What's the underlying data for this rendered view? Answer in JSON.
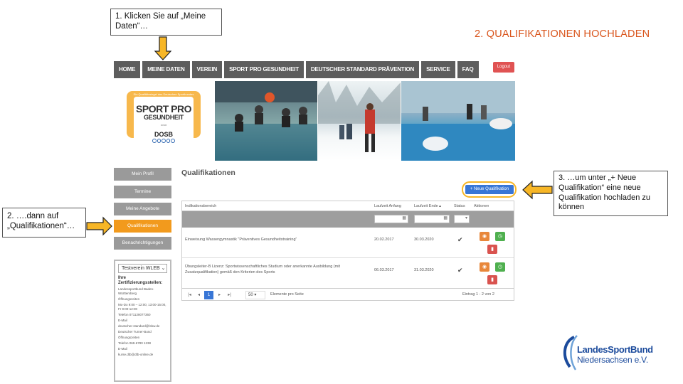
{
  "annotations": {
    "callout_1": "1. Klicken Sie auf „Meine Daten“…",
    "callout_2": "2. ….dann auf „Qualifikationen“…",
    "callout_3": "3. …um unter „+ Neue Qualifikation“ eine neue Qualifikation hochladen zu können",
    "slide_title": "2. QUALIFIKATIONEN HOCHLADEN",
    "step_1": "1",
    "step_2": "2",
    "colors": {
      "title": "#d9541b",
      "highlight": "#f7b626",
      "arrow": "#222222"
    }
  },
  "nav": {
    "items": [
      "HOME",
      "MEINE DATEN",
      "VEREIN",
      "SPORT PRO GESUNDHEIT",
      "DEUTSCHER STANDARD PRÄVENTION",
      "SERVICE",
      "FAQ"
    ],
    "login": "Logout"
  },
  "logo": {
    "topline": "Ein Qualitätssiegel des Deutschen Sportbundes",
    "line1": "SPORT PRO",
    "line2": "GESUNDHEIT",
    "sub": "DOSB",
    "dosb": "DOSB"
  },
  "sidebar": {
    "items": [
      "Mein Profil",
      "Termine",
      "Meine Angebote",
      "Qualifikationen",
      "Benachrichtigungen"
    ],
    "active_index": 3
  },
  "widget": {
    "select": "Testverein WLEB",
    "heading": "Ihre Zertifizierungsstellen:",
    "lines": [
      "Landessportbund Baden-Württemberg",
      "Öffnungszeiten",
      "Mo-Do 9:00 – 12:00, 13:00-15:00, Fr 9:00-12:00",
      "Telefon 071128077360",
      "E-Mail",
      "deutscher-standard@lsbw.de",
      "Deutscher Turner-Bund",
      "Öffnungszeiten",
      "Telefon 069-6780 1238",
      "E-Mail",
      "kurse.dtb@dtb-online.de"
    ]
  },
  "main": {
    "title": "Qualifikationen",
    "new_button": "+ Neue Qualifikation",
    "columns": [
      "Indikationsbereich",
      "Laufzeit Anfang",
      "Laufzeit Ende ▴",
      "Status",
      "Aktionen"
    ],
    "rows": [
      {
        "area": "Einweisung Wassergymnastik \"Präventives Gesundheitstraining\"",
        "start": "20.02.2017",
        "end": "30.03.2020",
        "status": "✔"
      },
      {
        "area": "Übungsleiter-B Lizenz: Sportwissenschaftliches Studium oder anerkannte Ausbildung (mit Zusatzqualifikation) gemäß den Kriterien des Sports",
        "start": "06.03.2017",
        "end": "31.03.2020",
        "status": "✔"
      }
    ],
    "pager": {
      "first": "|◂",
      "prev": "◂",
      "current": "1",
      "next": "▸",
      "last": "▸|",
      "per_page": "50",
      "per_page_label": "Elemente pro Seite",
      "summary": "Eintrag 1 - 2 von 2"
    }
  },
  "lsb_logo": {
    "line1": "LandesSportBund",
    "line2": "Niedersachsen e.V."
  }
}
